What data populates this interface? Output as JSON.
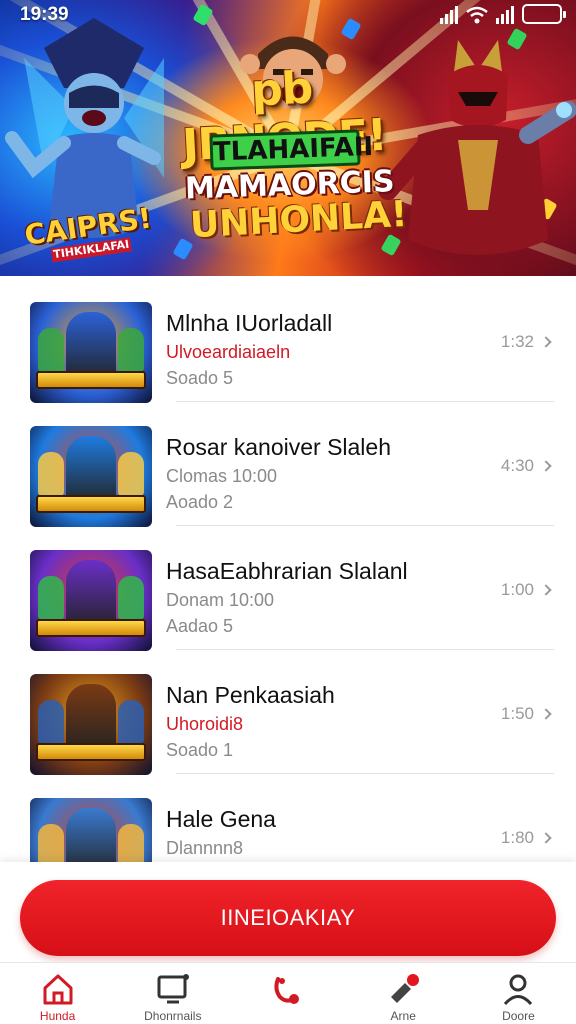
{
  "status_bar": {
    "time": "19:39"
  },
  "hero": {
    "title_line1": "pb JRNODE!",
    "title_line2": "TLAHAIFAII",
    "title_line3": "MAMAORCIS",
    "title_line4": "UNHONLA!",
    "badge_title": "CAIPRS!",
    "badge_sub": "TIHKIKLAFAI"
  },
  "games": [
    {
      "title": "Mlnha IUorladall",
      "sub1": "Ulvoeardiaiaeln",
      "sub1_red": true,
      "sub2": "Soado 5",
      "duration": "1:32",
      "thumb_label": "FLIOMPITAN",
      "colors": [
        "#2b62d8",
        "#f3a21c",
        "#3aa83c"
      ]
    },
    {
      "title": "Rosar kanoiver Slaleh",
      "sub1": "Clomas 10:00",
      "sub1_red": false,
      "sub2": "Aoado 2",
      "duration": "4:30",
      "thumb_label": "HALIKLAR",
      "colors": [
        "#1f7be0",
        "#e0462a",
        "#f7c948"
      ]
    },
    {
      "title": "HasaEabhrarian Slalanl",
      "sub1": "Donam 10:00",
      "sub1_red": false,
      "sub2": "Aadao 5",
      "duration": "1:00",
      "thumb_label": "GHAHIDAR",
      "colors": [
        "#6a2fc8",
        "#e63a2a",
        "#2fb84a"
      ]
    },
    {
      "title": "Nan Penkaasiah",
      "sub1": "Uhoroidi8",
      "sub1_red": true,
      "sub2": "Soado 1",
      "duration": "1:50",
      "thumb_label": "ROORBIIAN",
      "colors": [
        "#7a3a14",
        "#f0a21a",
        "#2c5fb0"
      ]
    },
    {
      "title": "Hale Gena",
      "sub1": "Dlannnn8",
      "sub1_red": false,
      "sub2": "",
      "duration": "1:80",
      "thumb_label": "",
      "colors": [
        "#3a7ad0",
        "#d0412a",
        "#f2b640"
      ]
    }
  ],
  "cta": {
    "label": "IINEIOAKIAY"
  },
  "nav": [
    {
      "label": "Hunda",
      "icon": "home-icon",
      "active": true
    },
    {
      "label": "Dhonrnails",
      "icon": "tv-icon",
      "active": false
    },
    {
      "label": "",
      "icon": "controller-icon",
      "active": false
    },
    {
      "label": "Arne",
      "icon": "tag-icon",
      "active": false
    },
    {
      "label": "Doore",
      "icon": "profile-icon",
      "active": false
    }
  ],
  "colors": {
    "accent": "#e3161d",
    "text_muted": "#8a8a8a",
    "text_red": "#d11a24"
  }
}
